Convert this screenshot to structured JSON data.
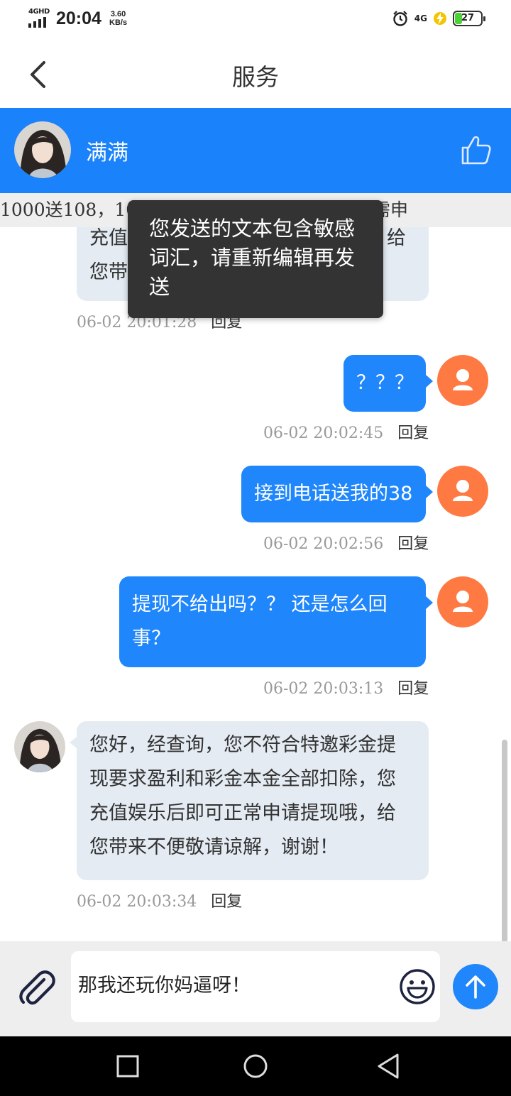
{
  "status_bar": {
    "network": "4GHD",
    "time": "20:04",
    "speed_value": "3.60",
    "speed_unit": "KB/s",
    "net_right": "4G",
    "battery": "27"
  },
  "nav": {
    "title": "服务"
  },
  "agent": {
    "name": "满满"
  },
  "marquee": {
    "text": "1000送108，10… 送… … 送… 存款即送，无需申"
  },
  "toast": {
    "text": "您发送的文本包含敏感词汇，请重新编辑再发送"
  },
  "messages": [
    {
      "side": "in",
      "lines": [
        "充值…………………………………给",
        "您带……………"
      ],
      "time": "06-02 20:01:28",
      "reply": "回复"
    },
    {
      "side": "out",
      "lines": [
        "？？？"
      ],
      "time": "06-02 20:02:45",
      "reply": "回复"
    },
    {
      "side": "out",
      "lines": [
        "接到电话送我的38"
      ],
      "time": "06-02 20:02:56",
      "reply": "回复"
    },
    {
      "side": "out",
      "lines": [
        "提现不给出吗？？ 还是怎么回",
        "事？"
      ],
      "time": "06-02 20:03:13",
      "reply": "回复"
    },
    {
      "side": "in",
      "lines": [
        "您好，经查询，您不符合特邀彩金提",
        "现要求盈利和彩金本金全部扣除，您",
        "充值娱乐后即可正常申请提现哦，给",
        "您带来不便敬请谅解，谢谢！"
      ],
      "time": "06-02 20:03:34",
      "reply": "回复"
    }
  ],
  "partial_in": {
    "line1": "充值",
    "line1_end": "给",
    "line2": "您带"
  },
  "input": {
    "value": "那我还玩你妈逼呀！"
  },
  "colors": {
    "primary": "#1a82fb",
    "user_avatar": "#ff7a43",
    "bubble_in": "#e4ebf3",
    "toast": "#333333"
  }
}
